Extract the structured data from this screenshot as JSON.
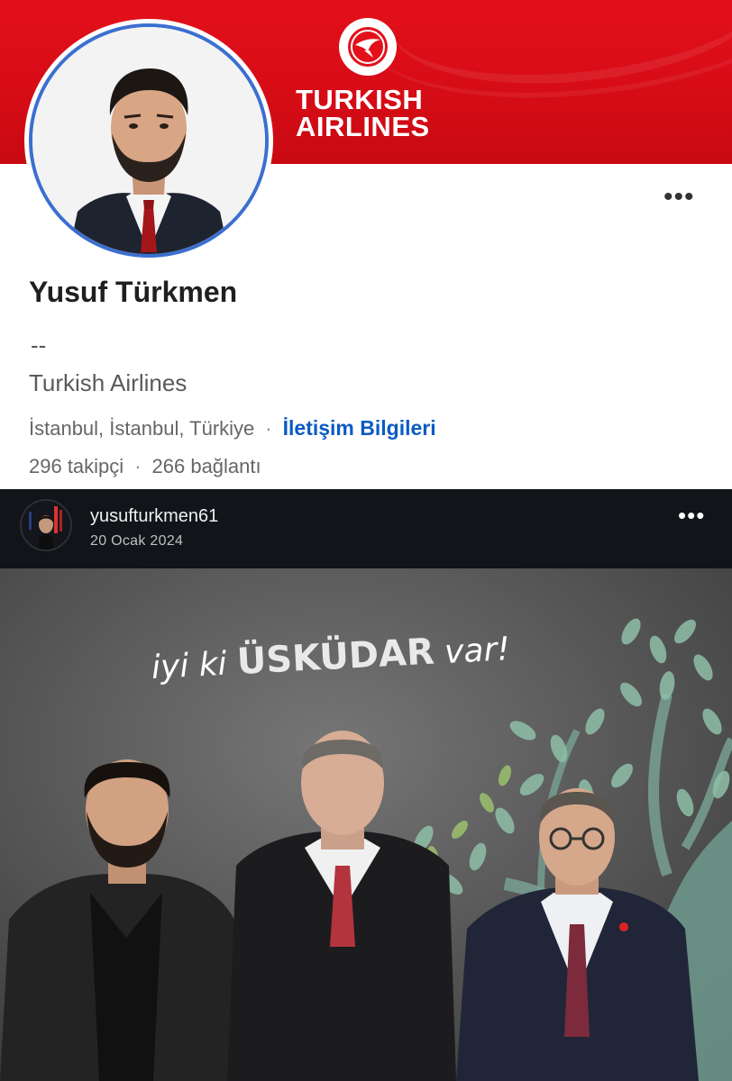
{
  "banner": {
    "logo_line1": "TURKISH",
    "logo_line2": "AIRLINES"
  },
  "profile": {
    "name": "Yusuf Türkmen",
    "headline": "--",
    "company": "Turkish Airlines",
    "location": "İstanbul, İstanbul, Türkiye",
    "separator": "·",
    "contact_link": "İletişim Bilgileri",
    "followers": "296 takipçi",
    "connections": "266 bağlantı",
    "more_icon": "more-horizontal-icon"
  },
  "post": {
    "username": "yusufturkmen61",
    "date": "20 Ocak 2024",
    "more_icon": "more-horizontal-icon",
    "photo_text_part1": "iyi ki",
    "photo_text_part2": "ÜSKÜDAR",
    "photo_text_part3": "var!"
  },
  "colors": {
    "brand_red": "#e3101b",
    "link_blue": "#0a5bc4",
    "avatar_ring": "#3b6fd0",
    "post_header_bg": "#111418"
  }
}
